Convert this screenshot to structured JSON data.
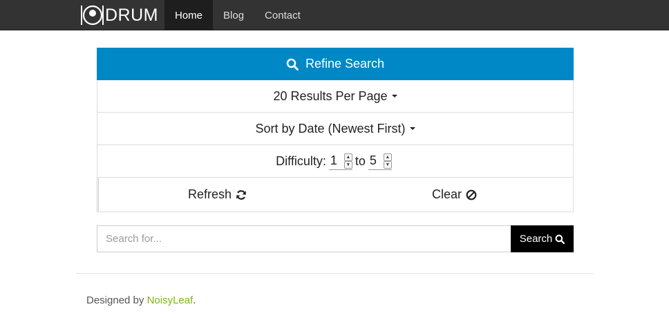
{
  "brand": {
    "name": "DRUM",
    "logo_icon": "drum-icon"
  },
  "nav": {
    "items": [
      {
        "label": "Home",
        "active": true
      },
      {
        "label": "Blog",
        "active": false
      },
      {
        "label": "Contact",
        "active": false
      }
    ]
  },
  "refine": {
    "header_label": "Refine Search",
    "header_icon": "search-icon",
    "results_per_page": "20 Results Per Page",
    "sort_by": "Sort by Date (Newest First)",
    "difficulty": {
      "label": "Difficulty:",
      "min": "1",
      "to": "to",
      "max": "5"
    },
    "refresh_label": "Refresh",
    "refresh_icon": "refresh-icon",
    "clear_label": "Clear",
    "clear_icon": "ban-icon"
  },
  "search": {
    "placeholder": "Search for...",
    "value": "",
    "button_label": "Search",
    "button_icon": "search-icon"
  },
  "footer": {
    "prefix": "Designed by ",
    "link": "NoisyLeaf",
    "suffix": "."
  },
  "colors": {
    "navbar": "#333333",
    "accent": "#0088c6",
    "footer_link": "#7cb518",
    "search_button": "#000000"
  }
}
